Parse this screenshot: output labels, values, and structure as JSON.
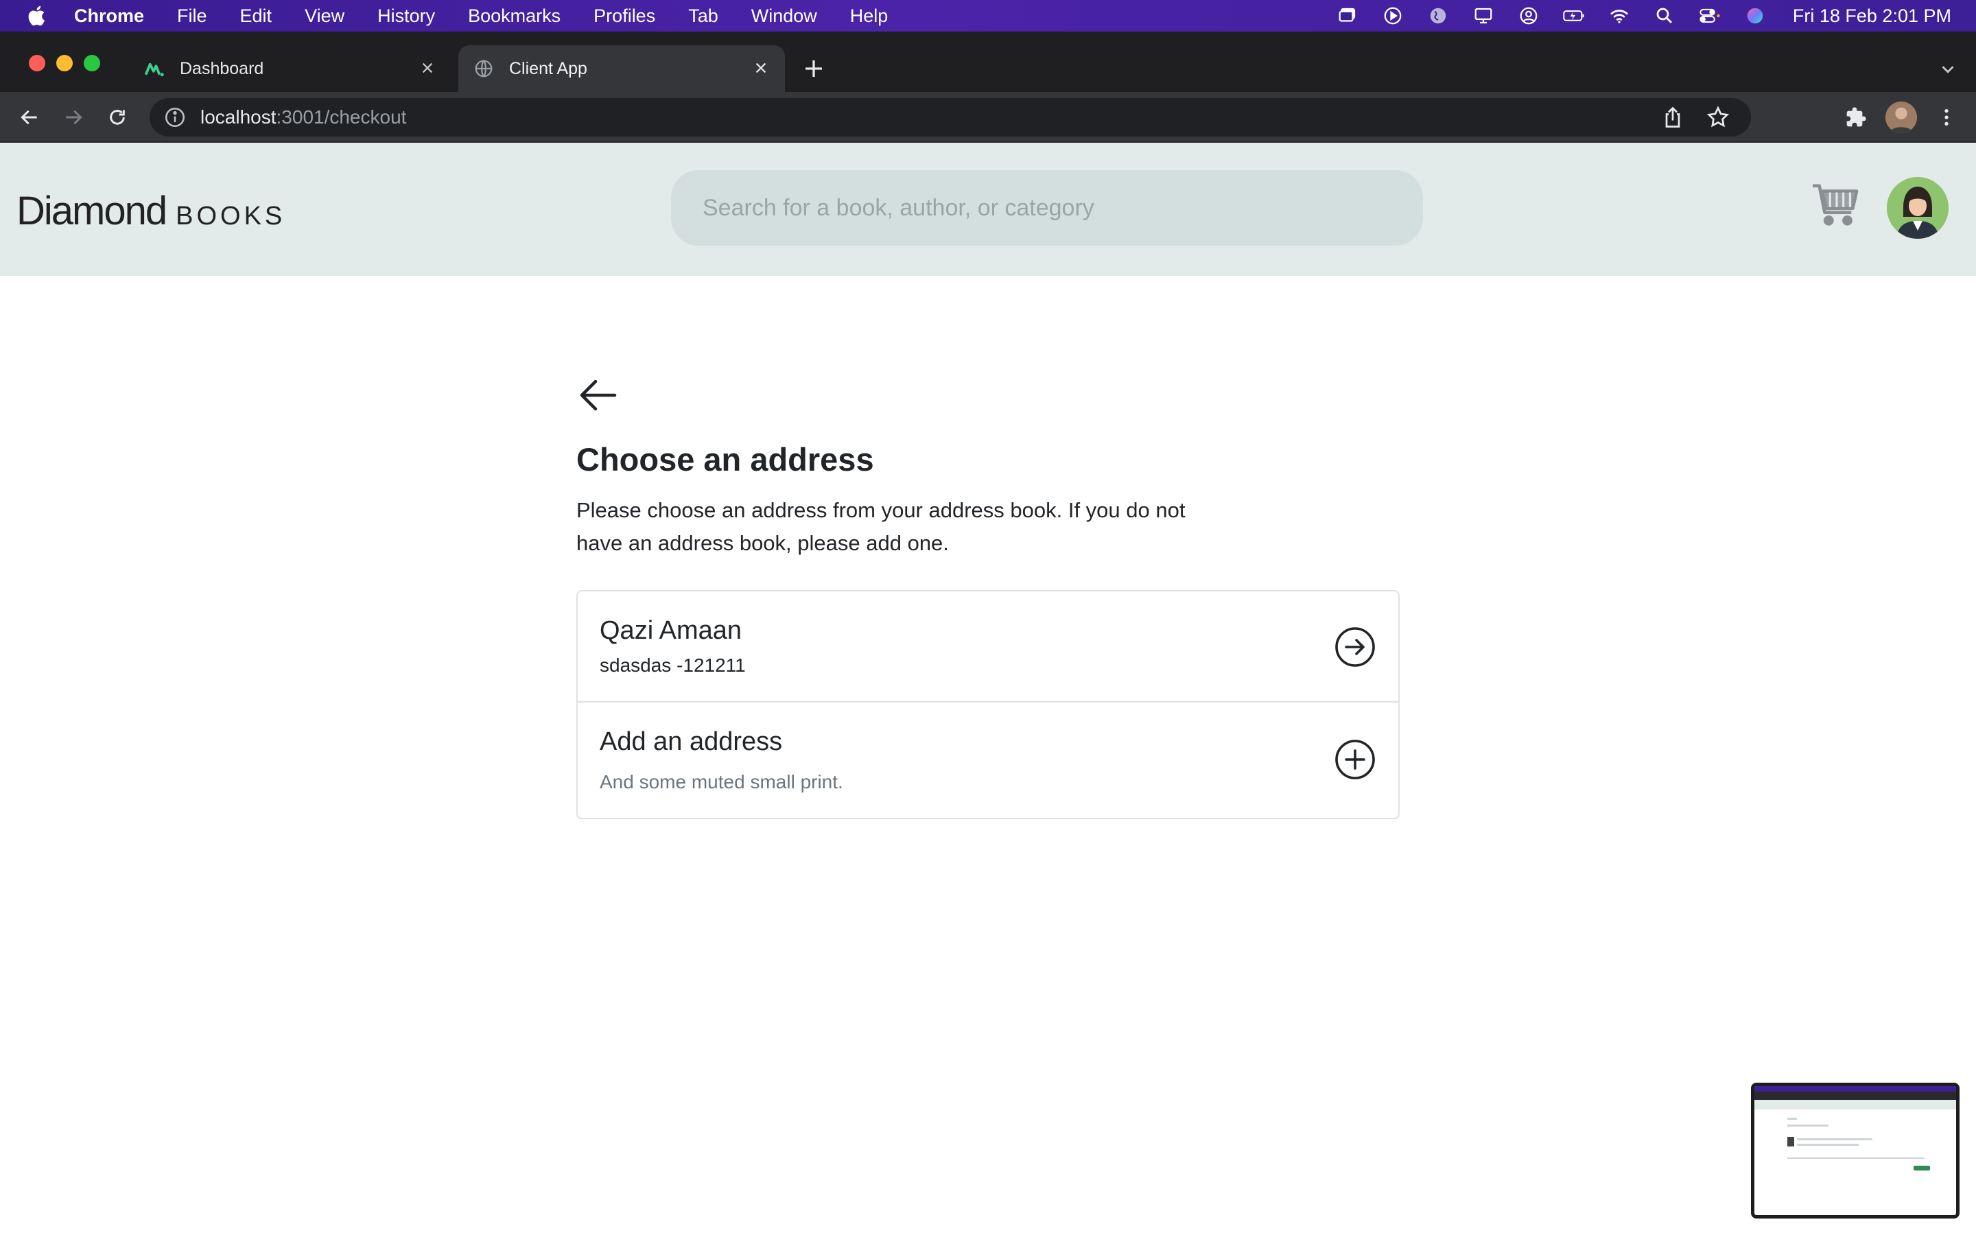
{
  "menubar": {
    "app_name": "Chrome",
    "items": [
      "File",
      "Edit",
      "View",
      "History",
      "Bookmarks",
      "Profiles",
      "Tab",
      "Window",
      "Help"
    ],
    "clock": "Fri 18 Feb  2:01 PM",
    "status_icons": [
      "screen-share-icon",
      "play-circle-icon",
      "globe-icon",
      "display-icon",
      "user-circle-icon",
      "battery-charging-icon",
      "wifi-icon",
      "spotlight-search-icon",
      "control-center-icon",
      "siri-icon"
    ]
  },
  "browser": {
    "tabs": [
      {
        "label": "Dashboard",
        "icon": "dashboard-favicon",
        "active": false
      },
      {
        "label": "Client App",
        "icon": "globe-favicon",
        "active": true
      }
    ],
    "url_host": "localhost",
    "url_path": ":3001/checkout"
  },
  "app": {
    "logo_main": "Diamond",
    "logo_sub": "BOOKS",
    "search_placeholder": "Search for a book, author, or category",
    "icons": [
      "cart-icon",
      "avatar"
    ]
  },
  "checkout": {
    "title": "Choose an address",
    "description": "Please choose an address from your address book. If you do not have an address book, please add one.",
    "addresses": [
      {
        "name": "Qazi Amaan",
        "detail": "sdasdas -121211"
      }
    ],
    "add_card": {
      "title": "Add an address",
      "subtitle": "And some muted small print."
    }
  },
  "colors": {
    "menubar": "#3d1f98",
    "header_bg": "#e3ebea",
    "search_bg": "#d3dfde",
    "text": "#212529",
    "muted": "#6c757d"
  }
}
